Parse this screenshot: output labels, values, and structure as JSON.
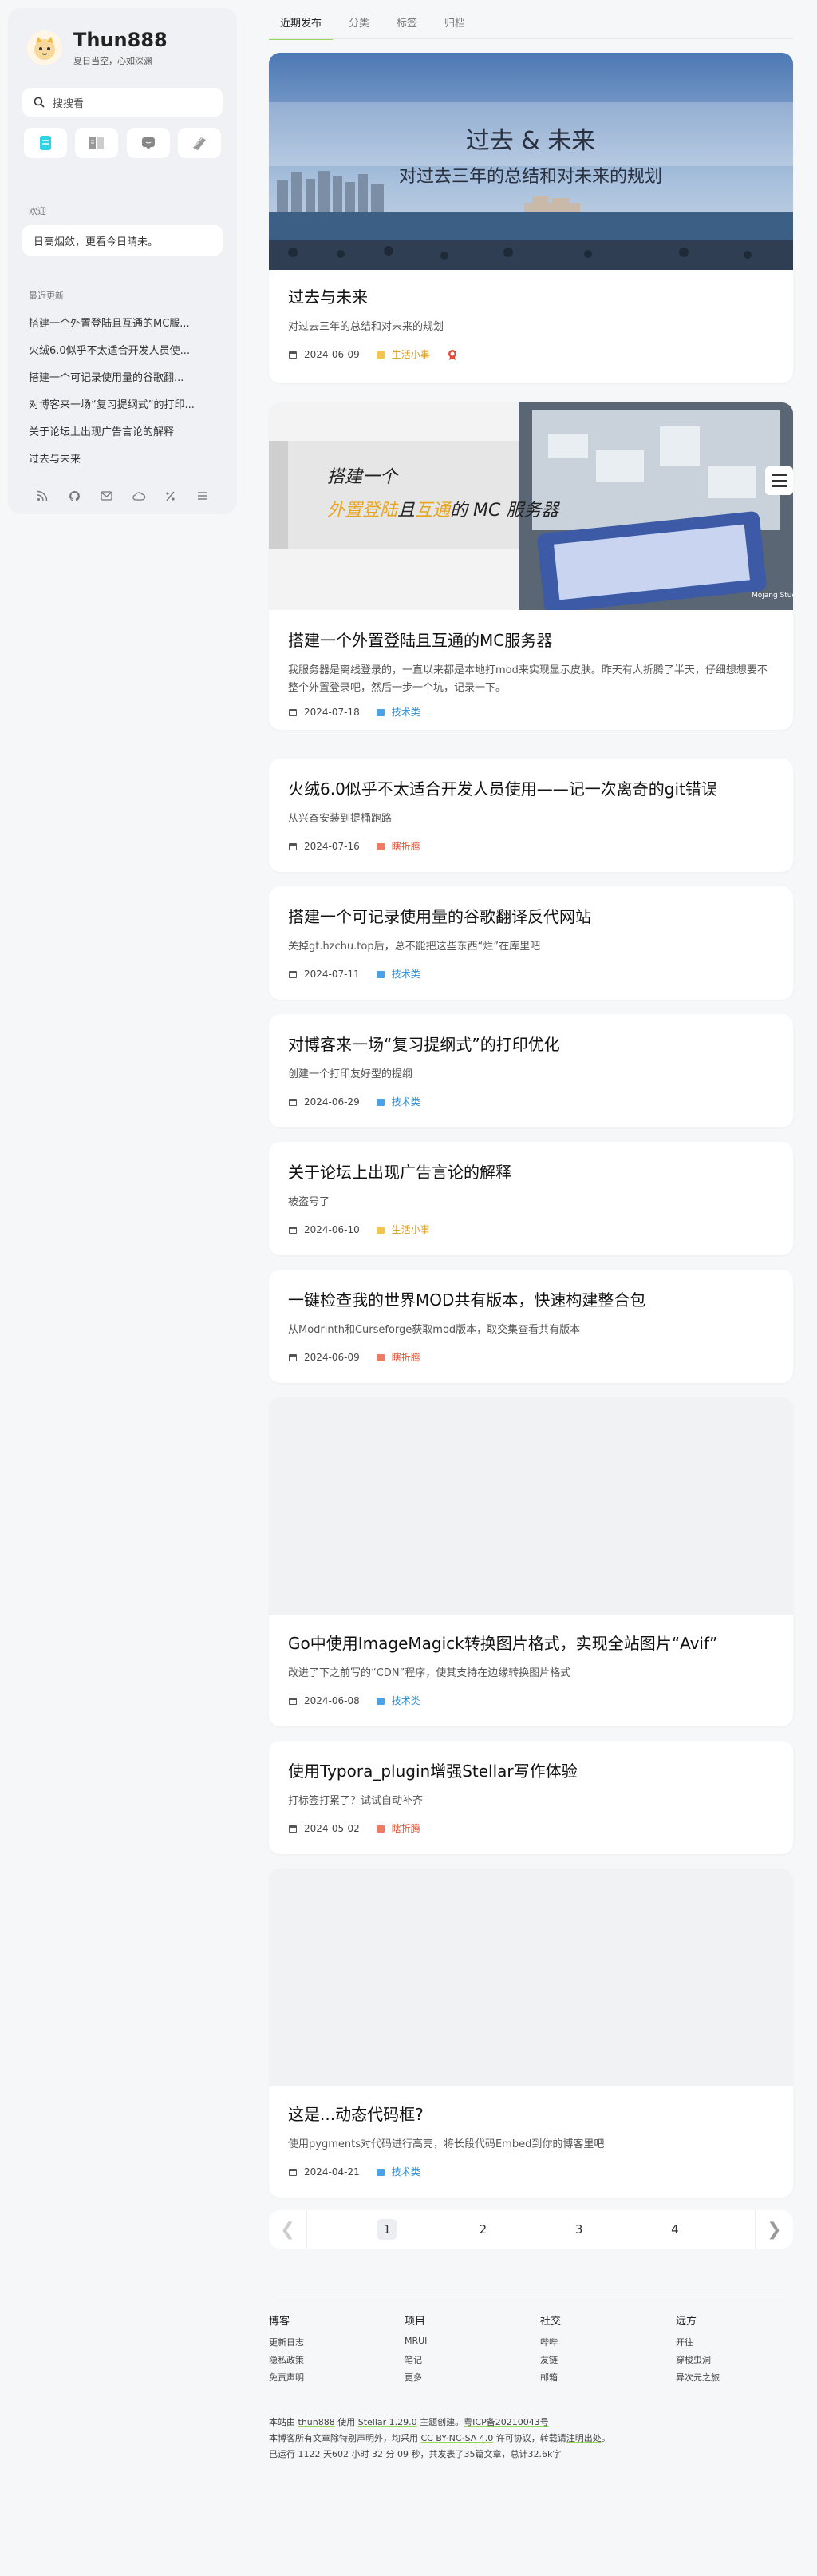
{
  "sidebar": {
    "title": "Thun888",
    "subtitle": "夏日当空，心如深渊",
    "search_placeholder": "搜搜看",
    "welcome_label": "欢迎",
    "welcome_text": "日高烟敛，更看今日晴未。",
    "recent_label": "最近更新",
    "recent": [
      "搭建一个外置登陆且互通的MC服...",
      "火绒6.0似乎不太适合开发人员使...",
      "搭建一个可记录使用量的谷歌翻...",
      "对博客来一场“复习提纲式”的打印...",
      "关于论坛上出现广告言论的解释",
      "过去与未来"
    ],
    "nav_icons": [
      "posts-icon",
      "wiki-icon",
      "message-icon",
      "notes-icon"
    ],
    "social_icons": [
      "rss-icon",
      "github-icon",
      "mail-icon",
      "cloud-icon",
      "slash-icon",
      "list-icon"
    ]
  },
  "tabs": [
    "近期发布",
    "分类",
    "标签",
    "归档"
  ],
  "posts": [
    {
      "title": "过去与未来",
      "desc": "对过去三年的总结和对未来的规划",
      "date": "2024-06-09",
      "category": "生活小事",
      "cat_color": "#d89a1e",
      "cover": {
        "kind": "sea",
        "line1": "过去 & 未来",
        "line2": "对过去三年的总结和对未来的规划"
      },
      "extra_badge": true
    },
    {
      "title": "搭建一个外置登陆且互通的MC服务器",
      "desc": "我服务器是离线登录的，一直以来都是本地打mod来实现显示皮肤。昨天有人折腾了半天，仔细想想要不整个外置登录吧，然后一步一个坑，记录一下。",
      "date": "2024-07-18",
      "category": "技术类",
      "cat_color": "#2f8fd6",
      "cover": {
        "kind": "mc",
        "line1": "搭建一个",
        "line2a": "外置登陆",
        "line2b": "且",
        "line2c": "互通",
        "line2d": "的 MC 服务器",
        "watermark": "Mojang Studios"
      }
    },
    {
      "title": "火绒6.0似乎不太适合开发人员使用——记一次离奇的git错误",
      "desc": "从兴奋安装到提桶跑路",
      "date": "2024-07-16",
      "category": "瞎折腾",
      "cat_color": "#e0563b"
    },
    {
      "title": "搭建一个可记录使用量的谷歌翻译反代网站",
      "desc": "关掉gt.hzchu.top后，总不能把这些东西“烂”在库里吧",
      "date": "2024-07-11",
      "category": "技术类",
      "cat_color": "#2f8fd6"
    },
    {
      "title": "对博客来一场“复习提纲式”的打印优化",
      "desc": "创建一个打印友好型的提纲",
      "date": "2024-06-29",
      "category": "技术类",
      "cat_color": "#2f8fd6"
    },
    {
      "title": "关于论坛上出现广告言论的解释",
      "desc": "被盗号了",
      "date": "2024-06-10",
      "category": "生活小事",
      "cat_color": "#d89a1e"
    },
    {
      "title": "一键检查我的世界MOD共有版本，快速构建整合包",
      "desc": "从Modrinth和Curseforge获取mod版本，取交集查看共有版本",
      "date": "2024-06-09",
      "category": "瞎折腾",
      "cat_color": "#e0563b"
    },
    {
      "title": "Go中使用ImageMagick转换图片格式，实现全站图片“Avif”",
      "desc": "改进了下之前写的“CDN”程序，使其支持在边缘转换图片格式",
      "date": "2024-06-08",
      "category": "技术类",
      "cat_color": "#2f8fd6",
      "cover": {
        "kind": "blank"
      }
    },
    {
      "title": "使用Typora_plugin增强Stellar写作体验",
      "desc": "打标签打累了？试试自动补齐",
      "date": "2024-05-02",
      "category": "瞎折腾",
      "cat_color": "#e0563b"
    },
    {
      "title": "这是...动态代码框?",
      "desc": "使用pygments对代码进行高亮，将长段代码Embed到你的博客里吧",
      "date": "2024-04-21",
      "category": "技术类",
      "cat_color": "#2f8fd6",
      "cover": {
        "kind": "blank"
      }
    }
  ],
  "pagination": {
    "pages": [
      "1",
      "2",
      "3",
      "4"
    ],
    "current": "1",
    "prev": "❮",
    "next": "❯"
  },
  "footer": {
    "columns": [
      {
        "title": "博客",
        "items": [
          "更新日志",
          "隐私政策",
          "免责声明"
        ]
      },
      {
        "title": "项目",
        "items": [
          "MRUI",
          "笔记",
          "更多"
        ]
      },
      {
        "title": "社交",
        "items": [
          "哔哔",
          "友链",
          "邮箱"
        ]
      },
      {
        "title": "远方",
        "items": [
          "开往",
          "穿梭虫洞",
          "异次元之旅"
        ]
      }
    ],
    "line1_a": "本站由 ",
    "line1_b": "thun888",
    "line1_c": " 使用 ",
    "line1_d": "Stellar 1.29.0",
    "line1_e": " 主题创建。",
    "line1_f": "粤ICP备20210043号",
    "line2_a": "本博客所有文章除特别声明外，均采用 ",
    "line2_b": "CC BY-NC-SA 4.0",
    "line2_c": " 许可协议，转载请",
    "line2_d": "注明出处",
    "line2_e": "。",
    "line3": "已运行 1122 天602 小时 32 分 09 秒，共发表了35篇文章，总计32.6k字"
  },
  "colors": {
    "accent": "#9bd55a",
    "tech": "#2f8fd6",
    "life": "#d89a1e",
    "tinker": "#e0563b"
  }
}
